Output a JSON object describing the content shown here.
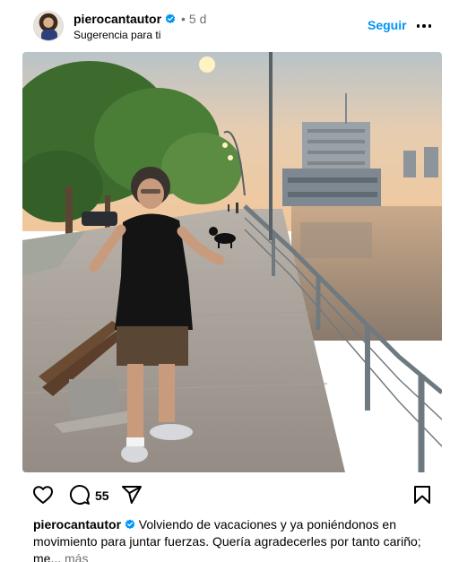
{
  "post": {
    "username": "pierocantautor",
    "separator": "•",
    "time": "5 d",
    "subtitle": "Sugerencia para ti",
    "follow_label": "Seguir",
    "comment_count": "55",
    "caption_text": "Volviendo de vacaciones y ya poniéndonos en movimiento para juntar fuerzas. Quería agradecerles por tanto cariño; me...",
    "more_label": "más",
    "verified": true
  },
  "icons": {
    "like": "heart-icon",
    "comment": "comment-icon",
    "share": "send-icon",
    "save": "bookmark-icon",
    "options": "more-options-icon",
    "verified": "verified-badge-icon"
  },
  "colors": {
    "accent": "#0095f6",
    "muted": "#737373",
    "text": "#000000"
  }
}
